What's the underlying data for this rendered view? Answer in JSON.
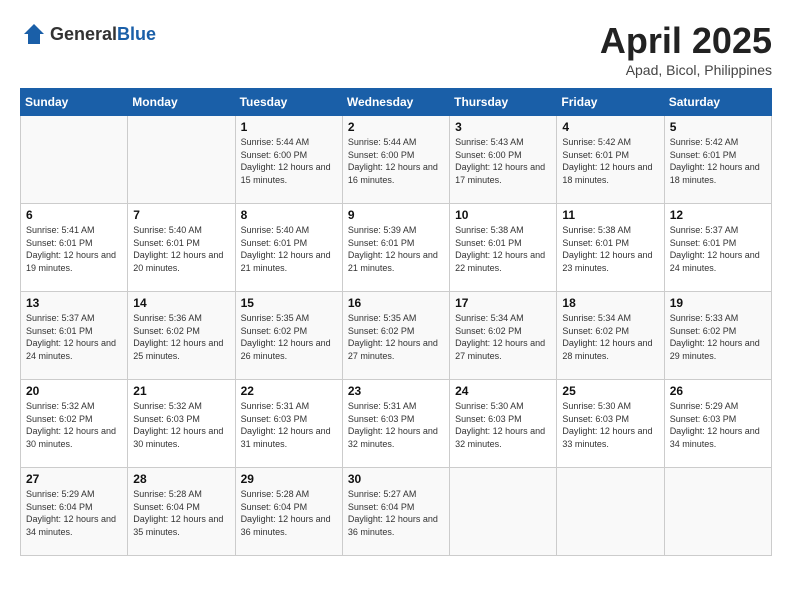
{
  "header": {
    "logo_general": "General",
    "logo_blue": "Blue",
    "month": "April 2025",
    "location": "Apad, Bicol, Philippines"
  },
  "weekdays": [
    "Sunday",
    "Monday",
    "Tuesday",
    "Wednesday",
    "Thursday",
    "Friday",
    "Saturday"
  ],
  "weeks": [
    [
      {
        "day": "",
        "sunrise": "",
        "sunset": "",
        "daylight": ""
      },
      {
        "day": "",
        "sunrise": "",
        "sunset": "",
        "daylight": ""
      },
      {
        "day": "1",
        "sunrise": "Sunrise: 5:44 AM",
        "sunset": "Sunset: 6:00 PM",
        "daylight": "Daylight: 12 hours and 15 minutes."
      },
      {
        "day": "2",
        "sunrise": "Sunrise: 5:44 AM",
        "sunset": "Sunset: 6:00 PM",
        "daylight": "Daylight: 12 hours and 16 minutes."
      },
      {
        "day": "3",
        "sunrise": "Sunrise: 5:43 AM",
        "sunset": "Sunset: 6:00 PM",
        "daylight": "Daylight: 12 hours and 17 minutes."
      },
      {
        "day": "4",
        "sunrise": "Sunrise: 5:42 AM",
        "sunset": "Sunset: 6:01 PM",
        "daylight": "Daylight: 12 hours and 18 minutes."
      },
      {
        "day": "5",
        "sunrise": "Sunrise: 5:42 AM",
        "sunset": "Sunset: 6:01 PM",
        "daylight": "Daylight: 12 hours and 18 minutes."
      }
    ],
    [
      {
        "day": "6",
        "sunrise": "Sunrise: 5:41 AM",
        "sunset": "Sunset: 6:01 PM",
        "daylight": "Daylight: 12 hours and 19 minutes."
      },
      {
        "day": "7",
        "sunrise": "Sunrise: 5:40 AM",
        "sunset": "Sunset: 6:01 PM",
        "daylight": "Daylight: 12 hours and 20 minutes."
      },
      {
        "day": "8",
        "sunrise": "Sunrise: 5:40 AM",
        "sunset": "Sunset: 6:01 PM",
        "daylight": "Daylight: 12 hours and 21 minutes."
      },
      {
        "day": "9",
        "sunrise": "Sunrise: 5:39 AM",
        "sunset": "Sunset: 6:01 PM",
        "daylight": "Daylight: 12 hours and 21 minutes."
      },
      {
        "day": "10",
        "sunrise": "Sunrise: 5:38 AM",
        "sunset": "Sunset: 6:01 PM",
        "daylight": "Daylight: 12 hours and 22 minutes."
      },
      {
        "day": "11",
        "sunrise": "Sunrise: 5:38 AM",
        "sunset": "Sunset: 6:01 PM",
        "daylight": "Daylight: 12 hours and 23 minutes."
      },
      {
        "day": "12",
        "sunrise": "Sunrise: 5:37 AM",
        "sunset": "Sunset: 6:01 PM",
        "daylight": "Daylight: 12 hours and 24 minutes."
      }
    ],
    [
      {
        "day": "13",
        "sunrise": "Sunrise: 5:37 AM",
        "sunset": "Sunset: 6:01 PM",
        "daylight": "Daylight: 12 hours and 24 minutes."
      },
      {
        "day": "14",
        "sunrise": "Sunrise: 5:36 AM",
        "sunset": "Sunset: 6:02 PM",
        "daylight": "Daylight: 12 hours and 25 minutes."
      },
      {
        "day": "15",
        "sunrise": "Sunrise: 5:35 AM",
        "sunset": "Sunset: 6:02 PM",
        "daylight": "Daylight: 12 hours and 26 minutes."
      },
      {
        "day": "16",
        "sunrise": "Sunrise: 5:35 AM",
        "sunset": "Sunset: 6:02 PM",
        "daylight": "Daylight: 12 hours and 27 minutes."
      },
      {
        "day": "17",
        "sunrise": "Sunrise: 5:34 AM",
        "sunset": "Sunset: 6:02 PM",
        "daylight": "Daylight: 12 hours and 27 minutes."
      },
      {
        "day": "18",
        "sunrise": "Sunrise: 5:34 AM",
        "sunset": "Sunset: 6:02 PM",
        "daylight": "Daylight: 12 hours and 28 minutes."
      },
      {
        "day": "19",
        "sunrise": "Sunrise: 5:33 AM",
        "sunset": "Sunset: 6:02 PM",
        "daylight": "Daylight: 12 hours and 29 minutes."
      }
    ],
    [
      {
        "day": "20",
        "sunrise": "Sunrise: 5:32 AM",
        "sunset": "Sunset: 6:02 PM",
        "daylight": "Daylight: 12 hours and 30 minutes."
      },
      {
        "day": "21",
        "sunrise": "Sunrise: 5:32 AM",
        "sunset": "Sunset: 6:03 PM",
        "daylight": "Daylight: 12 hours and 30 minutes."
      },
      {
        "day": "22",
        "sunrise": "Sunrise: 5:31 AM",
        "sunset": "Sunset: 6:03 PM",
        "daylight": "Daylight: 12 hours and 31 minutes."
      },
      {
        "day": "23",
        "sunrise": "Sunrise: 5:31 AM",
        "sunset": "Sunset: 6:03 PM",
        "daylight": "Daylight: 12 hours and 32 minutes."
      },
      {
        "day": "24",
        "sunrise": "Sunrise: 5:30 AM",
        "sunset": "Sunset: 6:03 PM",
        "daylight": "Daylight: 12 hours and 32 minutes."
      },
      {
        "day": "25",
        "sunrise": "Sunrise: 5:30 AM",
        "sunset": "Sunset: 6:03 PM",
        "daylight": "Daylight: 12 hours and 33 minutes."
      },
      {
        "day": "26",
        "sunrise": "Sunrise: 5:29 AM",
        "sunset": "Sunset: 6:03 PM",
        "daylight": "Daylight: 12 hours and 34 minutes."
      }
    ],
    [
      {
        "day": "27",
        "sunrise": "Sunrise: 5:29 AM",
        "sunset": "Sunset: 6:04 PM",
        "daylight": "Daylight: 12 hours and 34 minutes."
      },
      {
        "day": "28",
        "sunrise": "Sunrise: 5:28 AM",
        "sunset": "Sunset: 6:04 PM",
        "daylight": "Daylight: 12 hours and 35 minutes."
      },
      {
        "day": "29",
        "sunrise": "Sunrise: 5:28 AM",
        "sunset": "Sunset: 6:04 PM",
        "daylight": "Daylight: 12 hours and 36 minutes."
      },
      {
        "day": "30",
        "sunrise": "Sunrise: 5:27 AM",
        "sunset": "Sunset: 6:04 PM",
        "daylight": "Daylight: 12 hours and 36 minutes."
      },
      {
        "day": "",
        "sunrise": "",
        "sunset": "",
        "daylight": ""
      },
      {
        "day": "",
        "sunrise": "",
        "sunset": "",
        "daylight": ""
      },
      {
        "day": "",
        "sunrise": "",
        "sunset": "",
        "daylight": ""
      }
    ]
  ]
}
